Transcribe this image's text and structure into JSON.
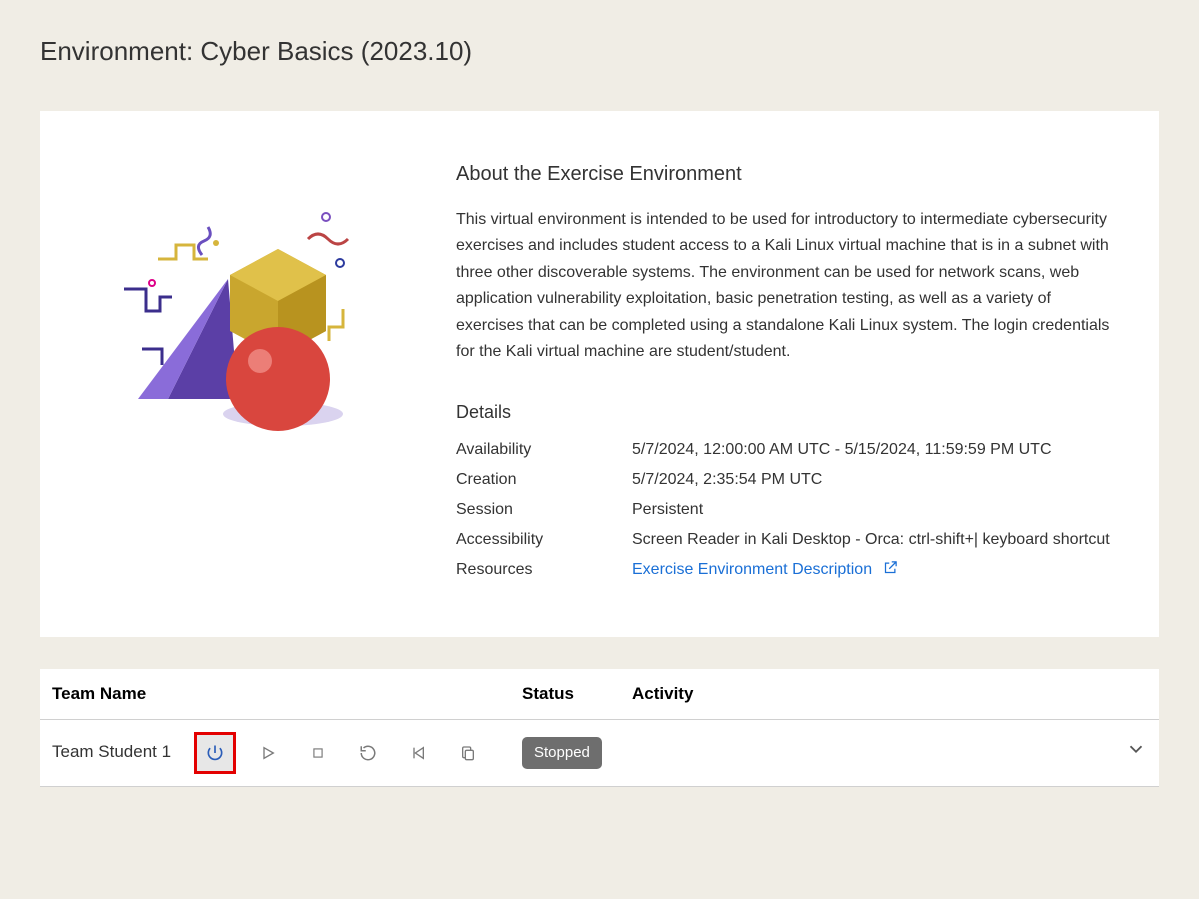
{
  "page_title": "Environment: Cyber Basics (2023.10)",
  "about": {
    "heading": "About the Exercise Environment",
    "description": "This virtual environment is intended to be used for introductory to intermediate cybersecurity exercises and includes student access to a Kali Linux virtual machine that is in a subnet with three other discoverable systems. The environment can be used for network scans, web application vulnerability exploitation, basic penetration testing, as well as a variety of exercises that can be completed using a standalone Kali Linux system. The login credentials for the Kali virtual machine are student/student."
  },
  "details": {
    "heading": "Details",
    "rows": {
      "availability": {
        "label": "Availability",
        "value": "5/7/2024, 12:00:00 AM UTC - 5/15/2024, 11:59:59 PM UTC"
      },
      "creation": {
        "label": "Creation",
        "value": "5/7/2024, 2:35:54 PM UTC"
      },
      "session": {
        "label": "Session",
        "value": "Persistent"
      },
      "accessibility": {
        "label": "Accessibility",
        "value": "Screen Reader in Kali Desktop - Orca: ctrl-shift+| keyboard shortcut"
      },
      "resources": {
        "label": "Resources",
        "link_text": "Exercise Environment Description"
      }
    }
  },
  "table": {
    "headers": {
      "team_name": "Team Name",
      "status": "Status",
      "activity": "Activity"
    },
    "row": {
      "name": "Team Student 1",
      "status": "Stopped",
      "activity": ""
    }
  },
  "icons": {
    "power": "power-icon",
    "play": "play-icon",
    "stop": "stop-icon",
    "restart": "restart-icon",
    "back": "step-back-icon",
    "copy": "copy-icon"
  }
}
